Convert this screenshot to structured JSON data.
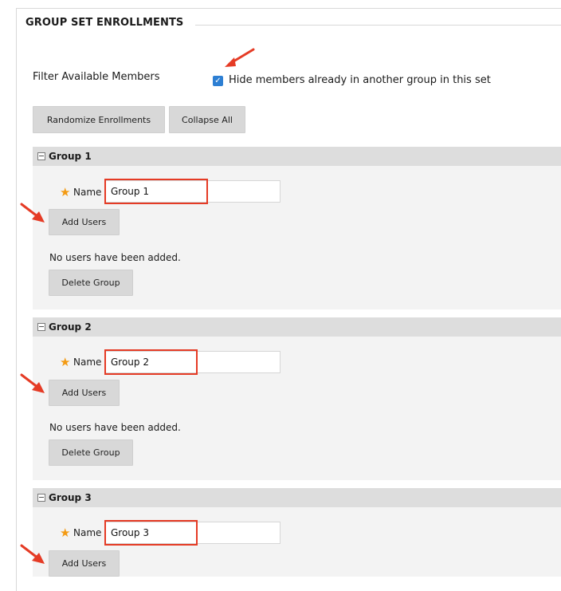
{
  "section": {
    "title": "GROUP SET ENROLLMENTS"
  },
  "filter": {
    "label": "Filter Available Members",
    "checkbox_label": "Hide members already in another group in this set",
    "checked": true,
    "check_glyph": "✓"
  },
  "toolbar": {
    "randomize_label": "Randomize Enrollments",
    "collapse_label": "Collapse All"
  },
  "groups": [
    {
      "title": "Group 1",
      "name_label": "Name",
      "name_value": "Group 1",
      "add_users_label": "Add Users",
      "no_users_text": "No users have been added.",
      "delete_label": "Delete Group"
    },
    {
      "title": "Group 2",
      "name_label": "Name",
      "name_value": "Group 2",
      "add_users_label": "Add Users",
      "no_users_text": "No users have been added.",
      "delete_label": "Delete Group"
    },
    {
      "title": "Group 3",
      "name_label": "Name",
      "name_value": "Group 3",
      "add_users_label": "Add Users"
    }
  ],
  "icons": {
    "required": "★",
    "collapse": "collapse-minus-icon",
    "annotation_arrow": "red-arrow-annotation"
  },
  "colors": {
    "checkbox_blue": "#2d7fd3",
    "required_star": "#f39a12",
    "annotation_red": "#e53b25",
    "group_header_bg": "#dddddd",
    "group_body_bg": "#f3f3f3",
    "button_bg": "#d8d8d8"
  }
}
